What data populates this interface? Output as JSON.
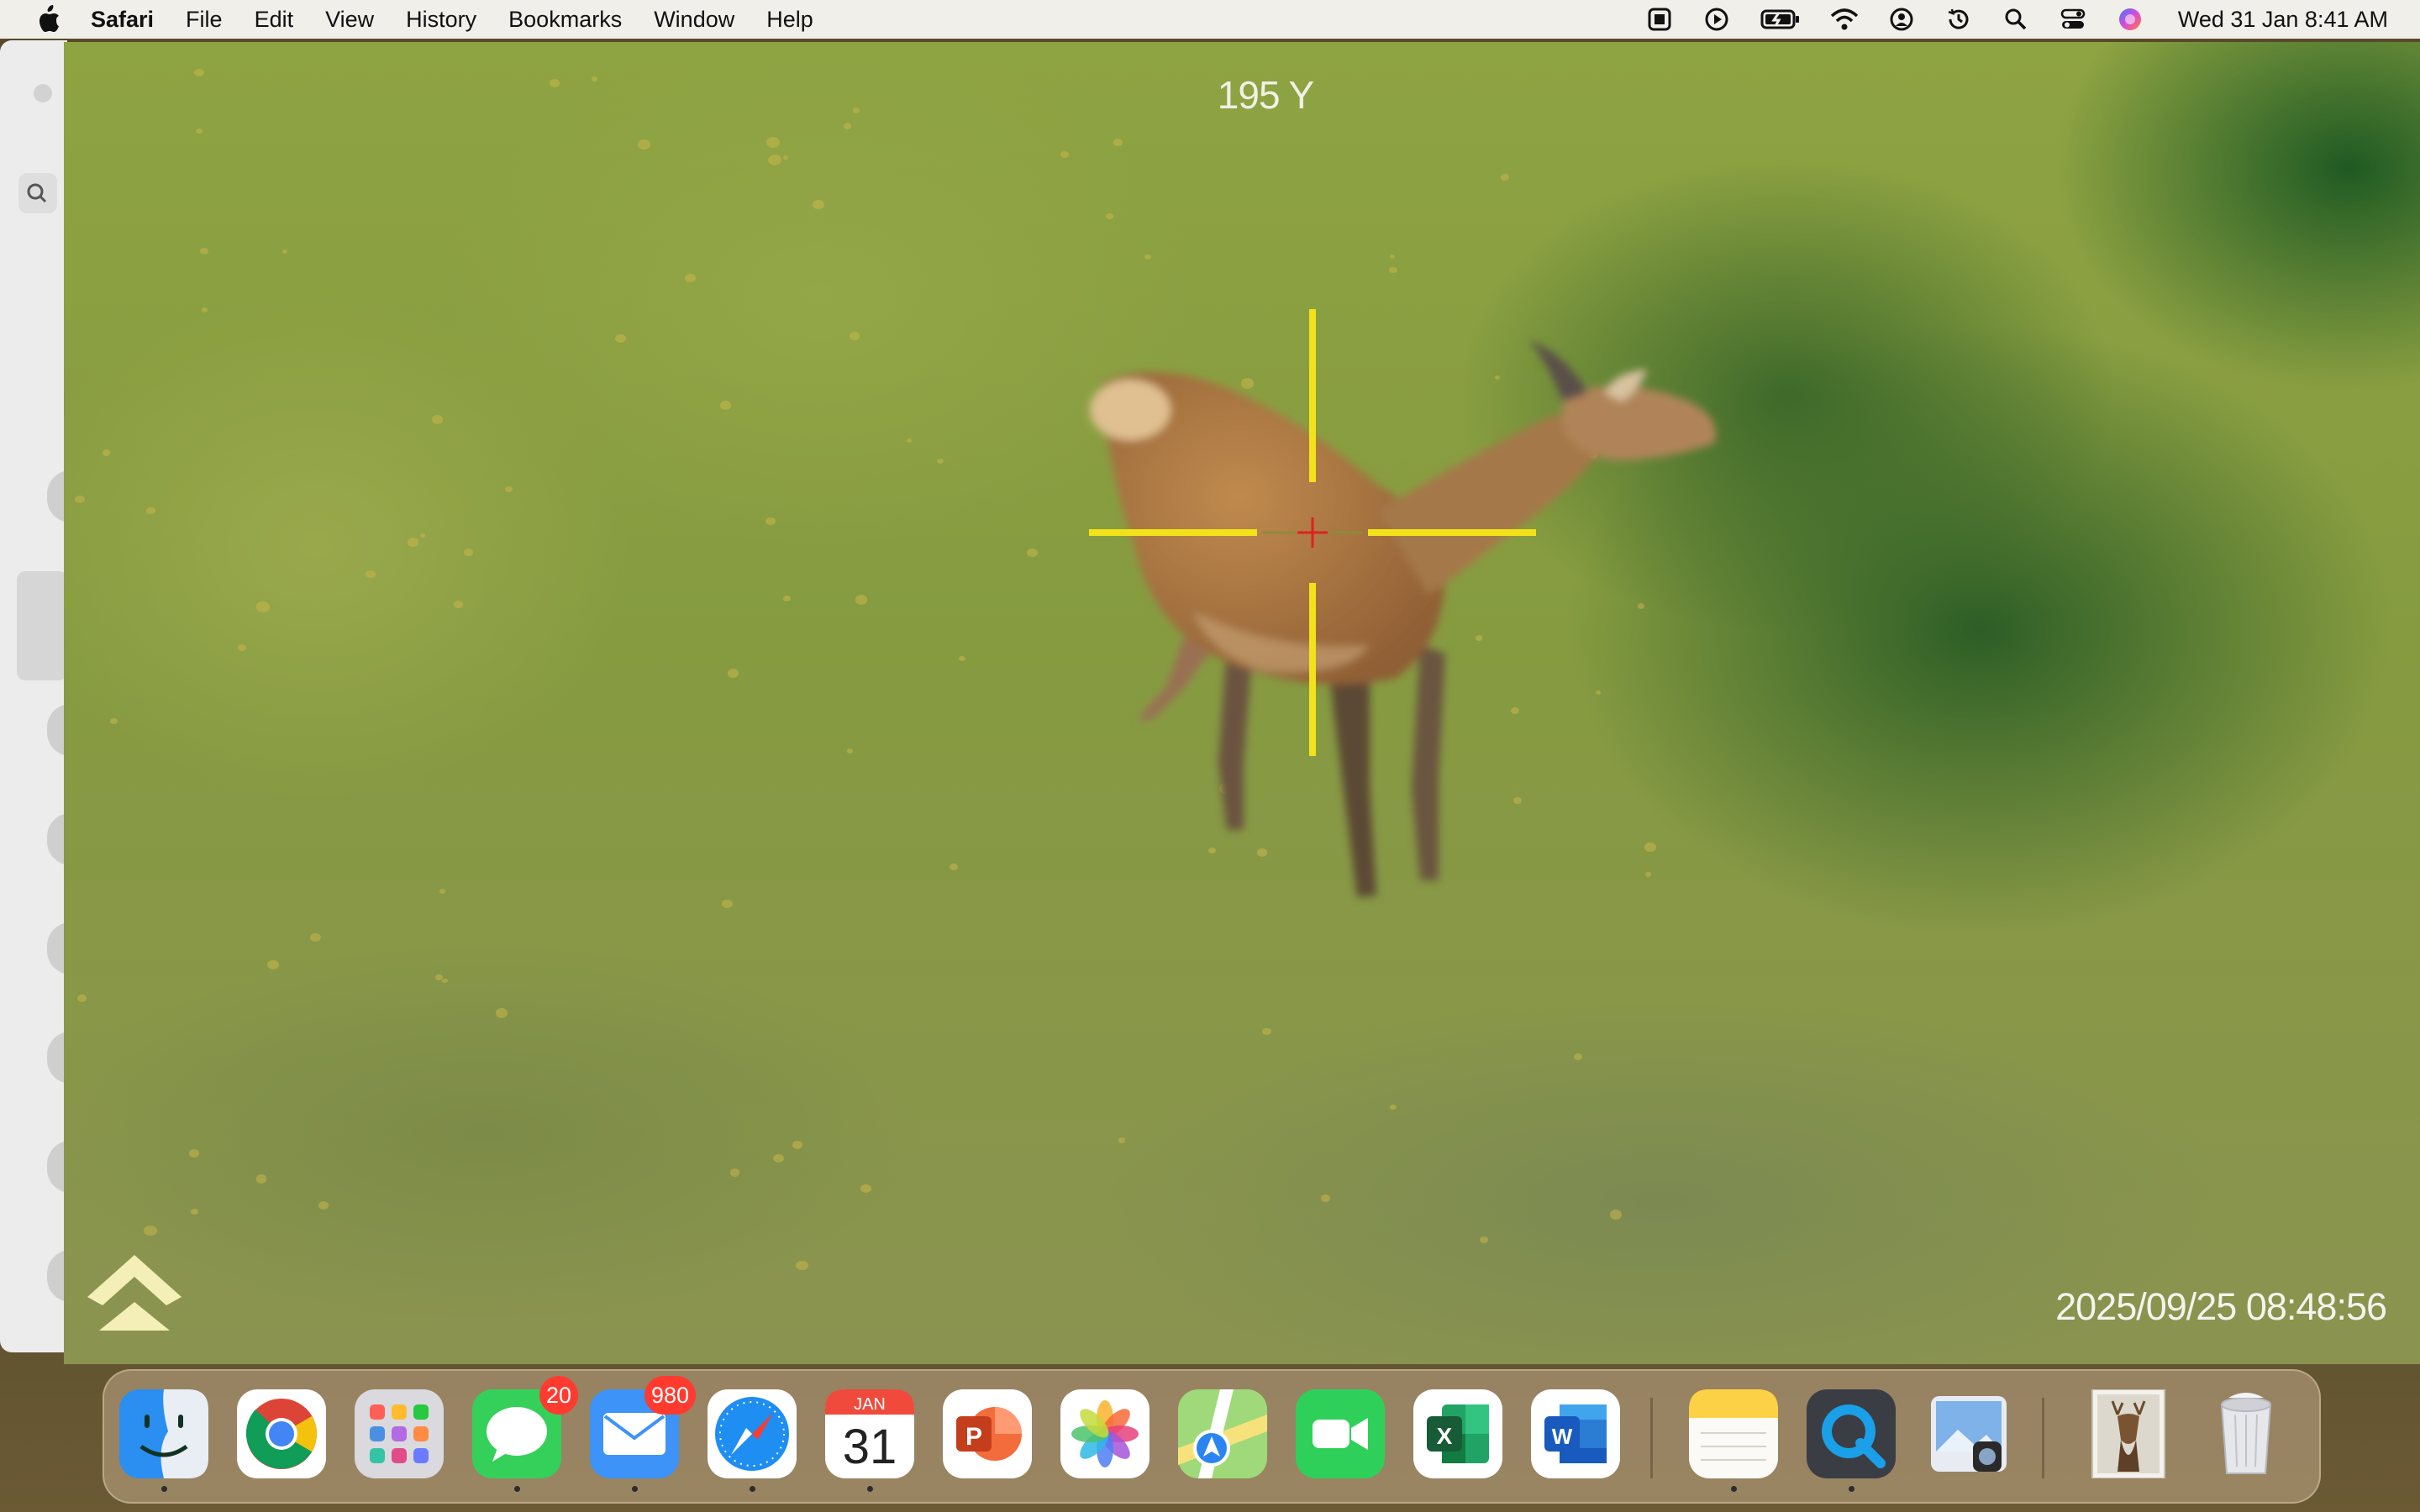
{
  "menubar": {
    "app_name": "Safari",
    "items": [
      "File",
      "Edit",
      "View",
      "History",
      "Bookmarks",
      "Window",
      "Help"
    ],
    "clock": "Wed 31 Jan  8:41 AM",
    "status_icons": [
      "vpn-icon",
      "play-icon",
      "battery-icon",
      "wifi-icon",
      "user-icon",
      "time-machine-icon",
      "spotlight-search-icon",
      "control-center-icon",
      "siri-icon"
    ]
  },
  "video": {
    "range_readout": "195 Y",
    "timestamp": "2025/09/25 08:48:56",
    "reticle_color": "#f2e21a",
    "center_mark_color": "#e02020"
  },
  "dock": {
    "apps": [
      {
        "name": "Finder",
        "icon": "finder-icon",
        "running": true
      },
      {
        "name": "Google Chrome",
        "icon": "chrome-icon",
        "running": false
      },
      {
        "name": "Launchpad",
        "icon": "launchpad-icon",
        "running": false
      },
      {
        "name": "Messages",
        "icon": "messages-icon",
        "badge": "20",
        "running": true
      },
      {
        "name": "Mail",
        "icon": "mail-icon",
        "badge": "980",
        "running": true
      },
      {
        "name": "Safari",
        "icon": "safari-icon",
        "running": true
      },
      {
        "name": "Calendar",
        "icon": "calendar-icon",
        "month": "JAN",
        "day": "31",
        "running": true
      },
      {
        "name": "PowerPoint",
        "icon": "powerpoint-icon",
        "running": false
      },
      {
        "name": "Photos",
        "icon": "photos-icon",
        "running": false
      },
      {
        "name": "Maps",
        "icon": "maps-icon",
        "running": false
      },
      {
        "name": "FaceTime",
        "icon": "facetime-icon",
        "running": false
      },
      {
        "name": "Excel",
        "icon": "excel-icon",
        "running": false
      },
      {
        "name": "Word",
        "icon": "word-icon",
        "running": false
      },
      {
        "name": "Notes",
        "icon": "notes-icon",
        "running": true
      },
      {
        "name": "QuickTime Player",
        "icon": "quicktime-icon",
        "running": true
      },
      {
        "name": "Preview",
        "icon": "preview-icon",
        "running": false
      },
      {
        "name": "Deer Image",
        "icon": "deer-thumbnail-icon",
        "running": false
      },
      {
        "name": "Trash",
        "icon": "trash-icon",
        "running": false
      }
    ]
  }
}
